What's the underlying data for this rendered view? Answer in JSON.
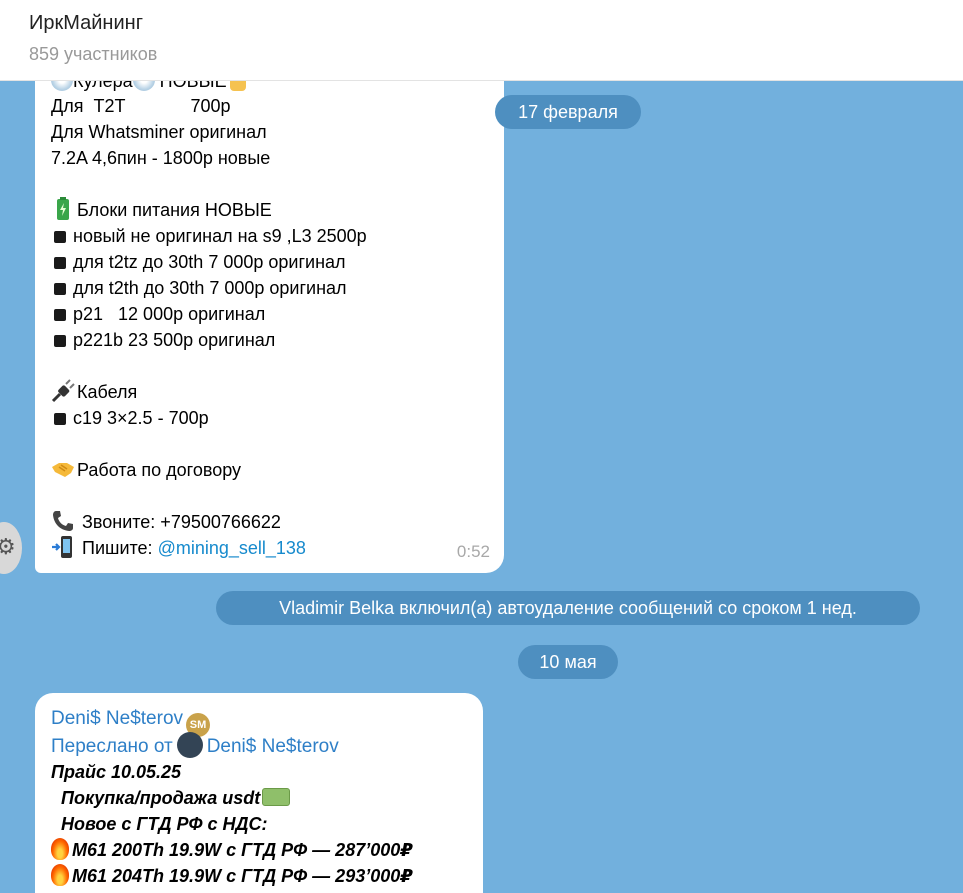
{
  "header": {
    "title": "ИркМайнинг",
    "subtitle": "859 участников"
  },
  "message1": {
    "line_coolers_title": "Кулера",
    "line_coolers_new": "НОВЫЕ",
    "line_t2t": "Для  Т2Т             700р",
    "line_whatsminer": "Для Whatsminer оригинал",
    "line_7_2a": "7.2A 4,6пин - 1800р новые",
    "line_psu_title": "Блоки питания НОВЫЕ",
    "psu_items": [
      "новый не оригинал на s9 ,L3 2500р",
      "для t2tz до 30th 7 000р оригинал",
      "для t2th до 30th 7 000р оригинал",
      "p21   12 000р оригинал",
      "p221b 23 500р оригинал"
    ],
    "line_cables_title": "Кабеля",
    "cable_items": [
      "c19 3×2.5 - 700р"
    ],
    "line_contract": "Работа по договору",
    "line_call": "Звоните: +79500766622",
    "line_write_prefix": "Пишите: ",
    "line_write_handle": "@mining_sell_138",
    "time": "0:52"
  },
  "date_pill_1": "17 февраля",
  "service_message": "Vladimir Belka включил(а) автоудаление сообщений со сроком 1 нед.",
  "date_pill_2": "10 мая",
  "message2": {
    "sender": "Deni$ Ne$terov",
    "forwarded_prefix": "Переслано от",
    "forwarded_from": "Deni$ Ne$terov",
    "line_price": "Прайс 10.05.25",
    "line_buy_sell": "Покупка/продажа usdt",
    "line_new_gtd": "Новое с ГТД РФ с НДС:",
    "line_m61_200": "M61 200Th 19.9W с ГТД РФ — 287’000₽",
    "line_m61_204": "M61 204Th 19.9W с ГТД РФ — 293’000₽"
  },
  "colors": {
    "chat_background": "#72b0dd",
    "pill_background": "#4e8fc0",
    "link": "#168acd",
    "sender_name": "#2e7fc7"
  },
  "icons": [
    "fan-icon",
    "pointing-down-icon",
    "battery-icon",
    "plug-icon",
    "handshake-icon",
    "phone-icon",
    "mobile-arrow-icon",
    "fire-icon",
    "money-icon",
    "verified-badge-icon"
  ]
}
